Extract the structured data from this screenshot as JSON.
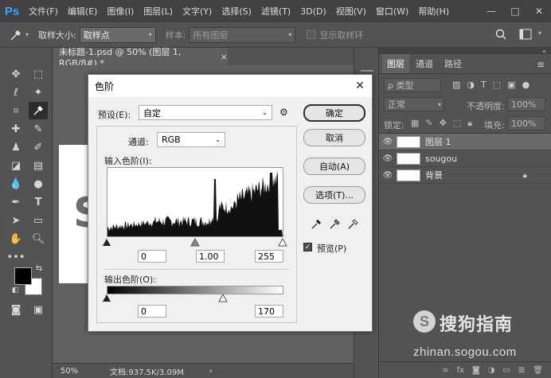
{
  "app": {
    "logo": "Ps",
    "menu": [
      "文件(F)",
      "编辑(E)",
      "图像(I)",
      "图层(L)",
      "文字(Y)",
      "选择(S)",
      "滤镜(T)",
      "3D(D)",
      "视图(V)",
      "窗口(W)",
      "帮助(H)"
    ],
    "window_controls": [
      "—",
      "□",
      "✕"
    ]
  },
  "options_bar": {
    "sample_size_label": "取样大小:",
    "sample_size_value": "取样点",
    "sample_label": "样本:",
    "sample_value": "所有图层",
    "show_ring_label": "显示取样环"
  },
  "document": {
    "tab_title": "未标题-1.psd @ 50% (图层 1, RGB/8#) *",
    "tab_close": "×",
    "zoom": "50%",
    "doc_size": "文档:937.5K/3.09M",
    "status_arrow": "›"
  },
  "layers_panel": {
    "tabs": [
      "图层",
      "通道",
      "路径"
    ],
    "filter_label": "ρ 类型",
    "blend_mode": "正常",
    "opacity_label": "不透明度:",
    "opacity_value": "100%",
    "lock_label": "锁定:",
    "fill_label": "填充:",
    "fill_value": "100%",
    "layers": [
      {
        "name": "图层 1",
        "selected": true
      },
      {
        "name": "sougou",
        "selected": false
      },
      {
        "name": "背景",
        "selected": false
      }
    ]
  },
  "levels_dialog": {
    "title": "色阶",
    "preset_label": "预设(E):",
    "preset_value": "自定",
    "channel_label": "通道:",
    "channel_value": "RGB",
    "input_levels_label": "输入色阶(I):",
    "input_black": "0",
    "input_gamma": "1.00",
    "input_white": "255",
    "output_levels_label": "输出色阶(O):",
    "output_black": "0",
    "output_white": "170",
    "buttons": {
      "ok": "确定",
      "cancel": "取消",
      "auto": "自动(A)",
      "options": "选项(T)..."
    },
    "preview_label": "预览(P)",
    "preview_checked": true,
    "close": "✕"
  },
  "watermark": {
    "logo_letter": "S",
    "title": "搜狗指南",
    "url": "zhinan.sogou.com"
  },
  "colors": {
    "accent": "#31a8ff",
    "foreground": "#000000",
    "background": "#ffffff"
  }
}
